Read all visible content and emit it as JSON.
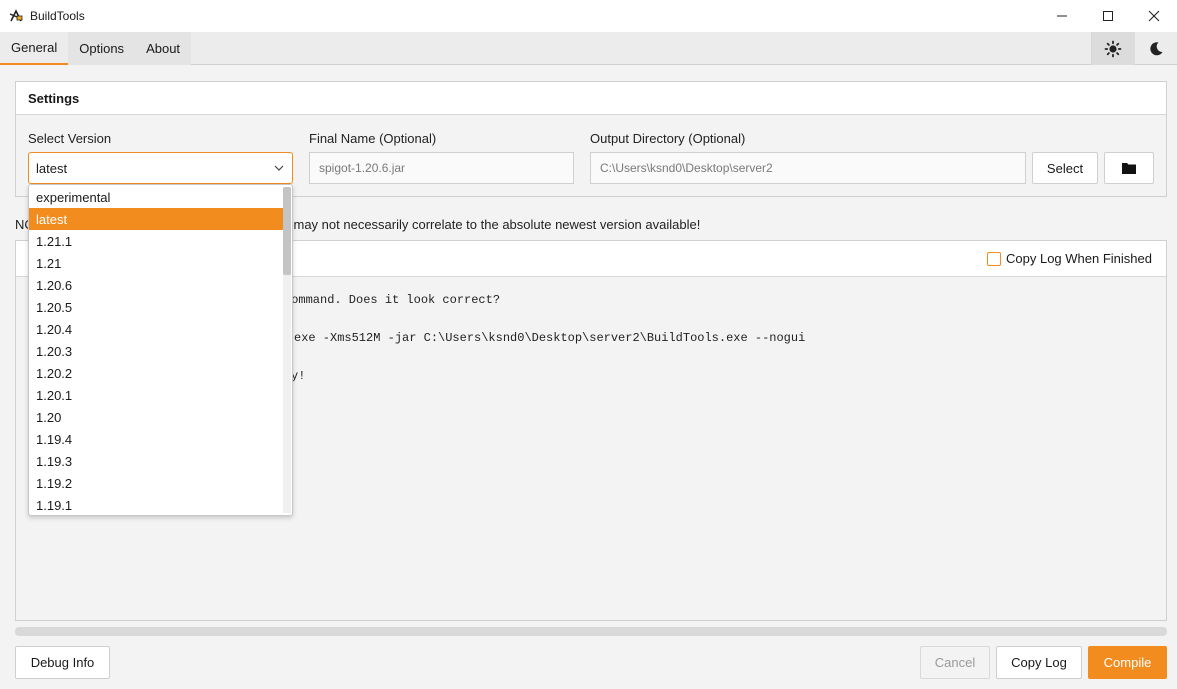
{
  "window": {
    "title": "BuildTools",
    "minimize_glyph": "—",
    "maximize_glyph": "☐",
    "close_glyph": "✕"
  },
  "tabs": [
    {
      "label": "General",
      "active": true
    },
    {
      "label": "Options",
      "active": false
    },
    {
      "label": "About",
      "active": false
    }
  ],
  "theme": {
    "light_icon": "sun-icon",
    "dark_icon": "moon-icon",
    "active": "light"
  },
  "settings": {
    "title": "Settings",
    "select_version_label": "Select Version",
    "selected_version": "latest",
    "final_name_label": "Final Name (Optional)",
    "final_name_placeholder": "spigot-1.20.6.jar",
    "output_dir_label": "Output Directory (Optional)",
    "output_dir_value": "C:\\Users\\ksnd0\\Desktop\\server2",
    "select_button": "Select",
    "folder_icon": "folder-icon"
  },
  "note": {
    "prefix": "NO",
    "suffix": "may not necessarily correlate to the absolute newest version available!"
  },
  "log": {
    "copy_when_finished_label": "Copy Log When Finished",
    "copy_when_finished_checked": false,
    "line1": "command. Does it look correct?",
    "line2": "exe -Xms512M -jar C:\\Users\\ksnd0\\Desktop\\server2\\BuildTools.exe --nogui",
    "line3": "y!"
  },
  "dropdown": {
    "options": [
      "experimental",
      "latest",
      "1.21.1",
      "1.21",
      "1.20.6",
      "1.20.5",
      "1.20.4",
      "1.20.3",
      "1.20.2",
      "1.20.1",
      "1.20",
      "1.19.4",
      "1.19.3",
      "1.19.2",
      "1.19.1"
    ],
    "selected": "latest"
  },
  "progress": {
    "value": 0
  },
  "buttons": {
    "debug_info": "Debug Info",
    "cancel": "Cancel",
    "copy_log": "Copy Log",
    "compile": "Compile"
  },
  "colors": {
    "accent": "#f28c1e",
    "background": "#f3f3f3"
  }
}
